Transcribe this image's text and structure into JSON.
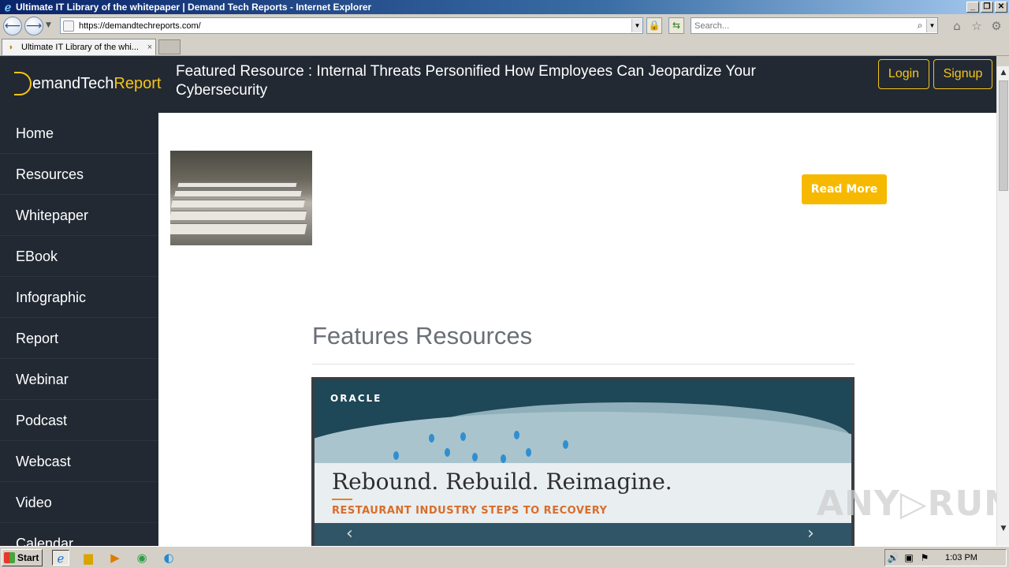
{
  "browser": {
    "window_title": "Ultimate IT Library of the whitepaper | Demand Tech Reports - Internet Explorer",
    "address": "https://demandtechreports.com/",
    "search_placeholder": "Search...",
    "tab_label": "Ultimate IT Library of the whi...",
    "tab_close": "×",
    "window_buttons": [
      "_",
      "❐",
      "✕"
    ]
  },
  "site": {
    "logo_text": "emandTech",
    "logo_report": "Report",
    "featured": "Featured Resource : Internal Threats Personified How Employees Can Jeopardize Your Cybersecurity",
    "login": "Login",
    "signup": "Signup",
    "nav": [
      "Home",
      "Resources",
      "Whitepaper",
      "EBook",
      "Infographic",
      "Report",
      "Webinar",
      "Podcast",
      "Webcast",
      "Video",
      "Calendar"
    ],
    "read_more": "Read More",
    "section_title": "Features Resources",
    "carousel": {
      "brand": "ORACLE",
      "headline": "Rebound. Rebuild. Reimagine.",
      "subheadline": "RESTAURANT INDUSTRY STEPS TO RECOVERY",
      "prev": "‹",
      "next": "›"
    },
    "watermark": "ANY▷RUN"
  },
  "taskbar": {
    "start": "Start",
    "clock": "1:03 PM"
  },
  "colors": {
    "header_bg": "#222933",
    "accent": "#f5c518",
    "read_more_bg": "#f7b900"
  }
}
